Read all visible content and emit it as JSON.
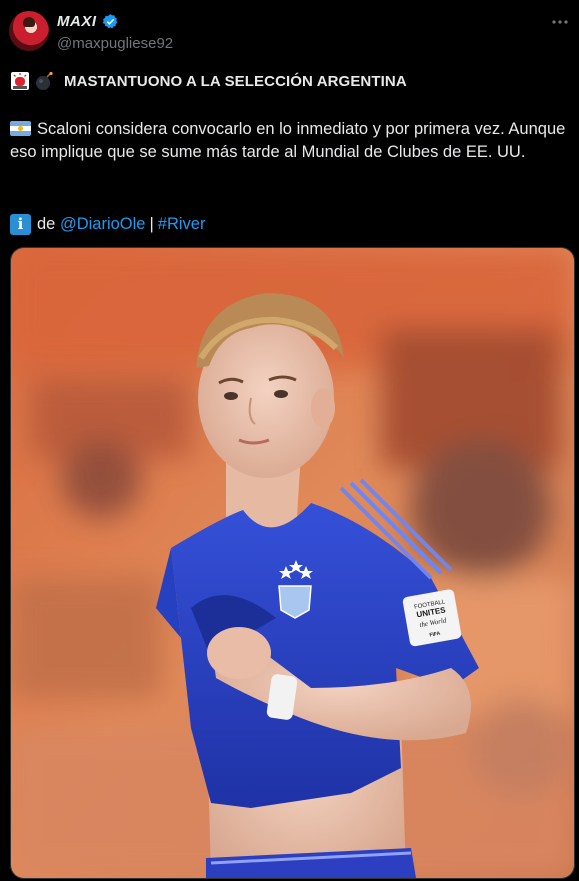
{
  "author": {
    "display_name": "MAXI",
    "handle": "@maxpugliese92",
    "avatar_icon": "profile-avatar",
    "verified_icon": "verified-badge-icon",
    "verified_color": "#1d9bf0"
  },
  "post": {
    "headline_icons": [
      "siren-icon",
      "bomb-icon"
    ],
    "headline": "MASTANTUONO A LA SELECCIÓN ARGENTINA",
    "flag_icon": "argentina-flag-icon",
    "body": "Scaloni considera convocarlo en lo inmediato y por primera vez. Aunque eso implique que se sume más tarde al Mundial de Clubes de EE. UU.",
    "source_icon": "information-icon",
    "source_prefix": "de",
    "mention": "@DiarioOle",
    "separator": "|",
    "hashtag": "#River"
  },
  "media": {
    "jersey_badge_line1": "FOOTBALL",
    "jersey_badge_line2": "UNITES",
    "jersey_badge_line3": "the World",
    "jersey_badge_line4": "FIFA"
  },
  "colors": {
    "background": "#000000",
    "text": "#e7e9ea",
    "secondary": "#71767b",
    "link": "#1d9bf0",
    "jersey": "#2d44c8"
  }
}
